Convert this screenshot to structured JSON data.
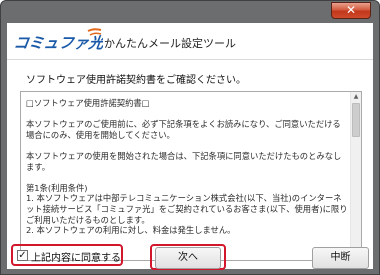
{
  "window": {
    "close_glyph": "✕"
  },
  "header": {
    "logo_text": "コミュファ光",
    "app_title": "かんたんメール設定ツール",
    "logo_color": "#1b5aa8",
    "logo_accent": "#e36a1c"
  },
  "prompt": "ソフトウェア使用許諾契約書をご確認ください。",
  "license": {
    "paragraphs": [
      "□ソフトウェア使用許諾契約書□",
      "本ソフトウェアのご使用前に、必ず下記条項をよくお読みになり、ご同意いただける場合にのみ、使用を開始してください。",
      "本ソフトウェアの使用を開始された場合は、下記条項に同意いただけたものとみなします。",
      "第1条(利用条件)"
    ],
    "clauses": [
      "1. 本ソフトウェアは中部テレコミュニケーション株式会社(以下、当社)のインターネット接続サービス「コミュファ光」をご契約されているお客さま(以下、使用者)に限りご利用いただけるものとします。",
      "2. 本ソフトウェアの利用に対し、料金は発生しません。"
    ]
  },
  "agree": {
    "checked_glyph": "✓",
    "label": "上記内容に同意する",
    "checked": true
  },
  "buttons": {
    "next": "次へ",
    "cancel": "中断"
  },
  "accent_color": "#d2172d"
}
